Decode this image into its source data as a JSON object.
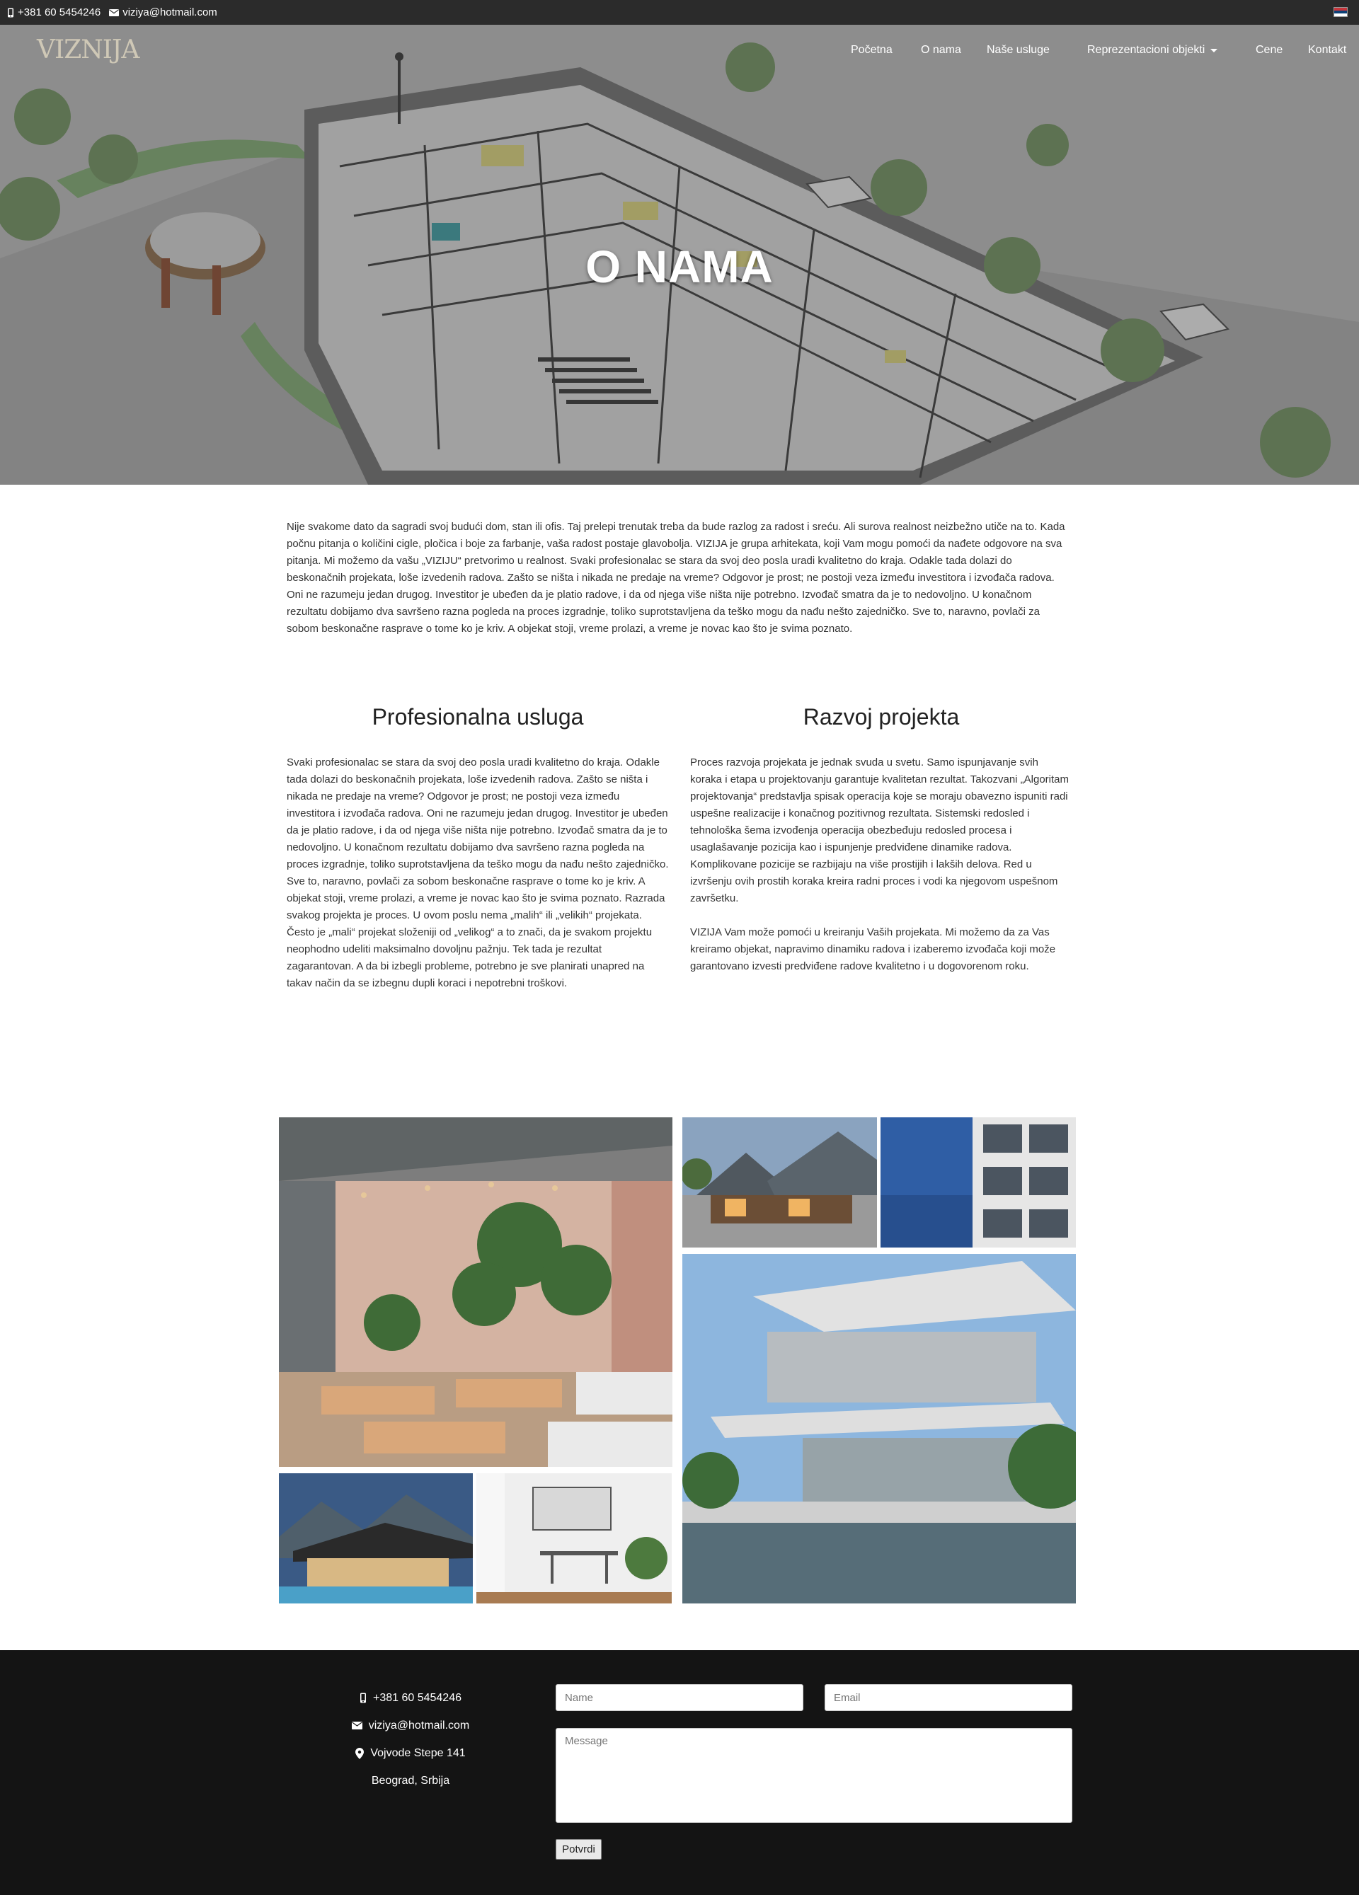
{
  "topbar": {
    "phone": "+381 60 5454246",
    "email": "viziya@hotmail.com",
    "phone_icon": "phone-icon",
    "email_icon": "envelope-icon",
    "language_flag": "serbian-flag-icon"
  },
  "brand": {
    "logo_text": "VIZNIJA"
  },
  "nav": {
    "items": [
      {
        "label": "Početna"
      },
      {
        "label": "O nama"
      },
      {
        "label": "Naše usluge"
      },
      {
        "label": "Reprezentacioni objekti"
      },
      {
        "label": "Cene"
      },
      {
        "label": "Kontakt"
      }
    ]
  },
  "hero": {
    "title": "O NAMA"
  },
  "intro": {
    "text": "Nije svakome dato da sagradi svoj budući dom, stan ili ofis. Taj prelepi trenutak treba da bude razlog za radost i sreću. Ali surova realnost neizbežno utiče na to. Kada počnu pitanja o količini cigle, pločica i boje za farbanje, vaša radost postaje glavobolja. VIZIJA je grupa arhitekata, koji Vam mogu pomoći da nađete odgovore na sva pitanja. Mi možemo da vašu „VIZIJU“ pretvorimo u realnost. Svaki profesionalac se stara da svoj deo posla uradi kvalitetno do kraja. Odakle tada dolazi do beskonačnih projekata, loše izvedenih radova. Zašto se ništa i nikada ne predaje na vreme? Odgovor je prost; ne postoji veza između investitora i izvođača radova. Oni ne razumeju jedan drugog. Investitor je ubeđen da je platio radove, i da od njega više ništa nije potrebno. Izvođač smatra da je to nedovoljno. U konačnom rezultatu dobijamo dva savršeno razna pogleda na proces izgradnje, toliko suprotstavljena da teško mogu da nađu nešto zajedničko. Sve to, naravno, povlači za sobom beskonačne rasprave o tome ko je kriv. A objekat stoji, vreme prolazi, a vreme je novac kao što je svima poznato."
  },
  "columns": [
    {
      "title": "Profesionalna usluga",
      "text": "Svaki profesionalac se stara da svoj deo posla uradi kvalitetno do kraja. Odakle tada dolazi do beskonačnih projekata, loše izvedenih radova. Zašto se ništa i nikada ne predaje na vreme? Odgovor je prost; ne postoji veza između investitora i izvođača radova. Oni ne razumeju jedan drugog. Investitor je ubeđen da je platio radove, i da od njega više ništa nije potrebno. Izvođač smatra da je to nedovoljno. U konačnom rezultatu dobijamo dva savršeno razna pogleda na proces izgradnje, toliko suprotstavljena da teško mogu da nađu nešto zajedničko. Sve to, naravno, povlači za sobom beskonačne rasprave o tome ko je kriv. A objekat stoji, vreme prolazi, a vreme je novac kao što je svima poznato. Razrada svakog projekta je proces. U ovom poslu nema „malih“ ili „velikih“ projekata. Često je „mali“ projekat složeniji od „velikog“ a to znači, da je svakom projektu neophodno udeliti maksimalno dovoljnu pažnju. Tek tada je rezultat zagarantovan. A da bi izbegli probleme, potrebno je sve planirati unapred na takav način da se izbegnu dupli koraci i nepotrebni troškovi."
    },
    {
      "title": "Razvoj projekta",
      "text": "Proces razvoja projekata je jednak svuda u svetu. Samo ispunjavanje svih koraka i etapa u projektovanju garantuje kvalitetan rezultat. Takozvani „Algoritam projektovanja“ predstavlja spisak operacija koje se moraju obavezno ispuniti radi uspešne realizacije i konačnog pozitivnog rezultata. Sistemski redosled i tehnološka šema izvođenja operacija obezbeđuju redosled procesa i usaglašavanje pozicija kao i ispunjenje predviđene dinamike radova. Komplikovane pozicije se razbijaju na više prostijih i lakših delova. Red u izvršenju ovih prostih koraka kreira radni proces i vodi ka njegovom uspešnom završetku.",
      "text2": "VIZIJA Vam može pomoći u kreiranju Vaših projekata. Mi možemo da za Vas kreiramo objekat, napravimo dinamiku radova i izaberemo izvođača koji može garantovano izvesti predviđene radove kvalitetno i u dogovorenom roku."
    }
  ],
  "footer": {
    "phone": "+381 60 5454246",
    "email": "viziya@hotmail.com",
    "address": "Vojvode Stepe 141",
    "city": "Beograd, Srbija",
    "name_placeholder": "Name",
    "email_placeholder": "Email",
    "message_placeholder": "Message",
    "submit_label": "Potvrdi"
  },
  "colors": {
    "topbar_bg": "#2b2b2b",
    "footer_bg": "#141414",
    "hero_overlay": "#8e8e8e"
  }
}
